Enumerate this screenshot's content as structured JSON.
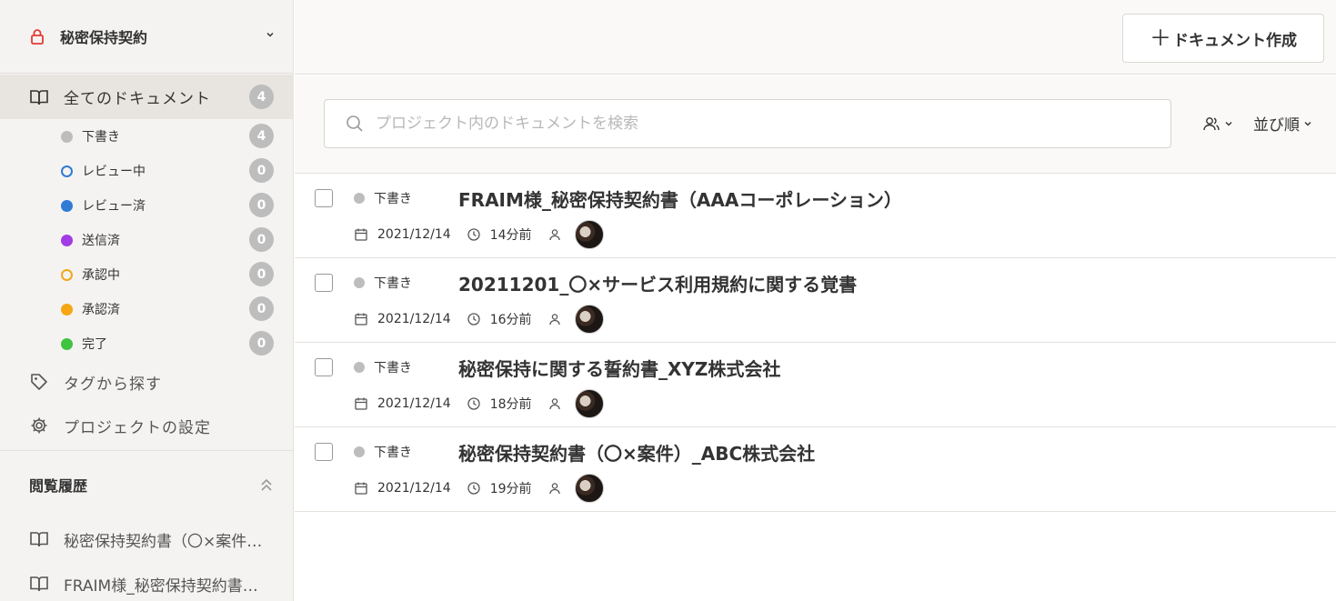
{
  "sidebar": {
    "project_name": "秘密保持契約",
    "all_docs": {
      "label": "全てのドキュメント",
      "count": "4"
    },
    "statuses": [
      {
        "label": "下書き",
        "count": "4",
        "color": "#bdbdbd",
        "style": "filled"
      },
      {
        "label": "レビュー中",
        "count": "0",
        "color": "#2f7bd6",
        "style": "ring"
      },
      {
        "label": "レビュー済",
        "count": "0",
        "color": "#2f7bd6",
        "style": "filled"
      },
      {
        "label": "送信済",
        "count": "0",
        "color": "#a23be6",
        "style": "filled"
      },
      {
        "label": "承認中",
        "count": "0",
        "color": "#f2a71b",
        "style": "ring"
      },
      {
        "label": "承認済",
        "count": "0",
        "color": "#f5a612",
        "style": "filled"
      },
      {
        "label": "完了",
        "count": "0",
        "color": "#3fc43f",
        "style": "filled"
      }
    ],
    "tags_label": "タグから探す",
    "settings_label": "プロジェクトの設定",
    "history_title": "閲覧履歴",
    "history": [
      {
        "label": "秘密保持契約書（〇×案件）_ABC株式会社"
      },
      {
        "label": "FRAIM様_秘密保持契約書（AAAコーポレーション）"
      }
    ]
  },
  "toolbar": {
    "create_plus": "＋",
    "create_label": "ドキュメント作成"
  },
  "search": {
    "placeholder": "プロジェクト内のドキュメントを検索",
    "sort_label": "並び順"
  },
  "documents": [
    {
      "status": "下書き",
      "title": "FRAIM様_秘密保持契約書（AAAコーポレーション）",
      "date": "2021/12/14",
      "ago": "14分前"
    },
    {
      "status": "下書き",
      "title": "20211201_〇×サービス利用規約に関する覚書",
      "date": "2021/12/14",
      "ago": "16分前"
    },
    {
      "status": "下書き",
      "title": "秘密保持に関する誓約書_XYZ株式会社",
      "date": "2021/12/14",
      "ago": "18分前"
    },
    {
      "status": "下書き",
      "title": "秘密保持契約書（〇×案件）_ABC株式会社",
      "date": "2021/12/14",
      "ago": "19分前"
    }
  ],
  "colors": {
    "accent_lock": "#e53935",
    "draft_dot": "#bdbdbd",
    "sidebar_bg": "#f5f3f1"
  }
}
